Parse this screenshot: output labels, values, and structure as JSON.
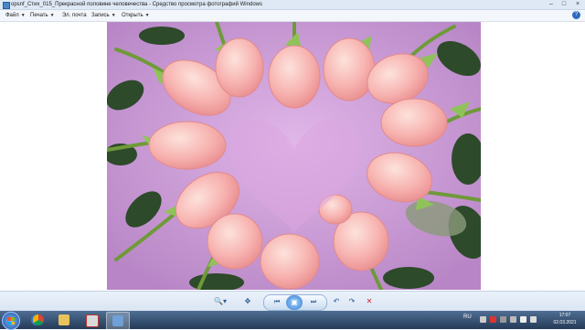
{
  "window": {
    "title": "opsnf_Стих_015_Прекрасной половине человечества - Средство просмотра фотографий Windows"
  },
  "menu": {
    "items": [
      {
        "label": "Файл"
      },
      {
        "label": "Печать"
      },
      {
        "label": "Эл. почта"
      },
      {
        "label": "Запись"
      },
      {
        "label": "Открыть"
      }
    ]
  },
  "toolbar": {
    "zoom_icon": "magnifier-icon",
    "fit_icon": "fit-window-icon",
    "prev_icon": "previous-icon",
    "slideshow_icon": "slideshow-icon",
    "next_icon": "next-icon",
    "rotate_left_icon": "rotate-left-icon",
    "rotate_right_icon": "rotate-right-icon",
    "delete_icon": "delete-icon"
  },
  "taskbar": {
    "lang": "RU",
    "time": "17:07",
    "date": "02.03.2021"
  },
  "colors": {
    "accent": "#2f6bc2",
    "photo_background": "#c79ad6",
    "rose_petal": "#f7b3b0",
    "leaf": "#2d4a2a"
  }
}
